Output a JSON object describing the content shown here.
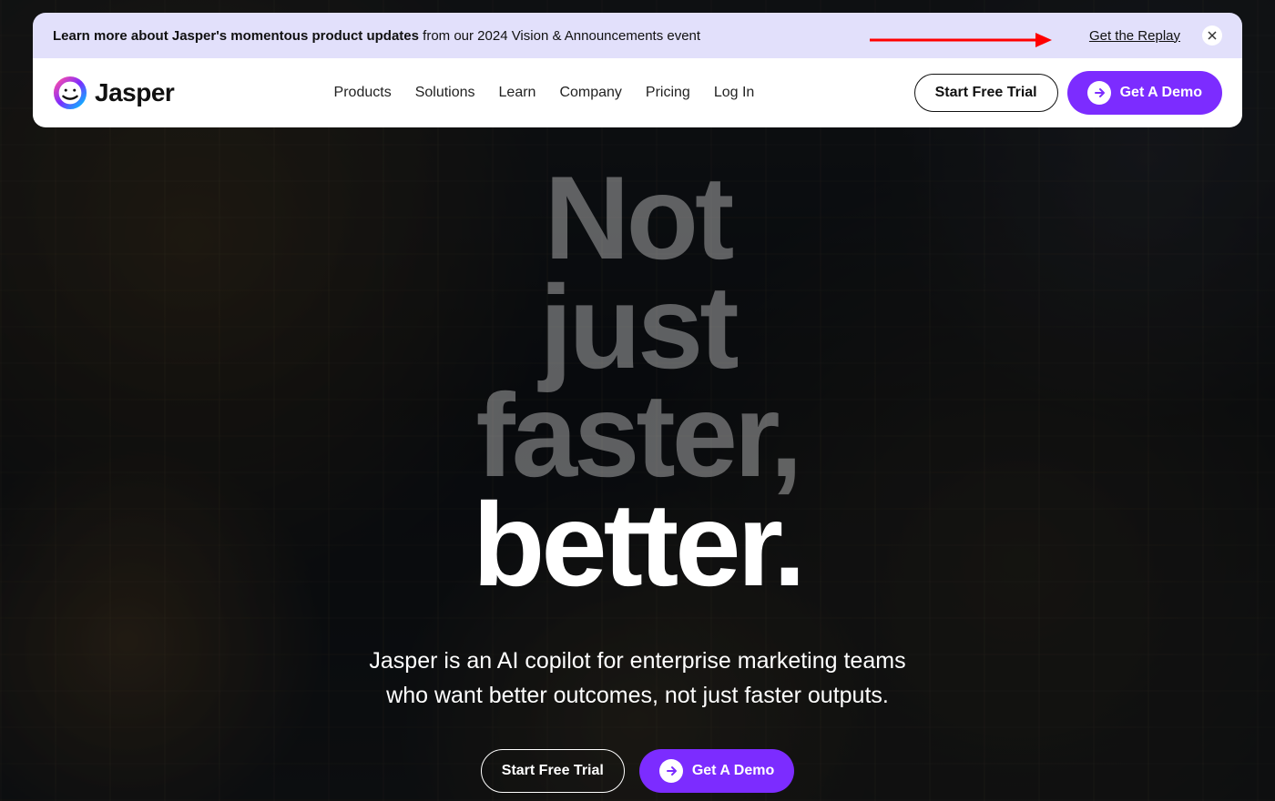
{
  "announce": {
    "bold": "Learn more about Jasper's momentous product updates",
    "rest": " from our 2024 Vision & Announcements event",
    "cta": "Get the Replay",
    "close_icon": "close-icon"
  },
  "brand": {
    "name": "Jasper"
  },
  "nav": {
    "items": [
      {
        "label": "Products"
      },
      {
        "label": "Solutions"
      },
      {
        "label": "Learn"
      },
      {
        "label": "Company"
      },
      {
        "label": "Pricing"
      },
      {
        "label": "Log In"
      }
    ],
    "trial": "Start Free Trial",
    "demo": "Get A Demo"
  },
  "hero": {
    "line1": "Not",
    "line2": "just",
    "line3": "faster,",
    "line4": "better.",
    "sub1": "Jasper is an AI copilot for enterprise marketing teams",
    "sub2": "who want better outcomes, not just faster outputs.",
    "trial": "Start Free Trial",
    "demo": "Get A Demo"
  },
  "colors": {
    "purple": "#7c2cff",
    "banner_bg": "#e2e0fb"
  }
}
